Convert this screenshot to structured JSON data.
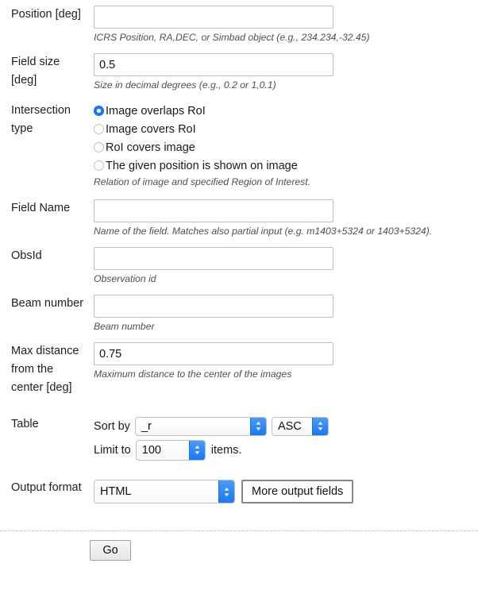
{
  "form": {
    "fields": {
      "position": {
        "label": "Position [deg]",
        "value": "",
        "placeholder": "",
        "hint": "ICRS Position, RA,DEC, or Simbad object (e.g., 234.234,-32.45)"
      },
      "field_size": {
        "label": "Field size [deg]",
        "value": "0.5",
        "placeholder": "",
        "hint": "Size in decimal degrees (e.g., 0.2 or 1,0.1)"
      },
      "intersection_type": {
        "label": "Intersection type",
        "hint": "Relation of image and specified Region of Interest.",
        "selected": "Image overlaps RoI",
        "options": [
          {
            "label": "Image overlaps RoI",
            "checked": true
          },
          {
            "label": "Image covers RoI",
            "checked": false
          },
          {
            "label": "RoI covers image",
            "checked": false
          },
          {
            "label": "The given position is shown on image",
            "checked": false
          }
        ]
      },
      "field_name": {
        "label": "Field Name",
        "value": "",
        "placeholder": "",
        "hint": "Name of the field. Matches also partial input (e.g. m1403+5324 or 1403+5324)."
      },
      "obsid": {
        "label": "ObsId",
        "value": "",
        "placeholder": "",
        "hint": "Observation id"
      },
      "beam_number": {
        "label": "Beam number",
        "value": "",
        "placeholder": "",
        "hint": "Beam number"
      },
      "max_distance": {
        "label": "Max distance from the center [deg]",
        "value": "0.75",
        "placeholder": "",
        "hint": "Maximum distance to the center of the images"
      },
      "table": {
        "label": "Table",
        "sort_by_label": "Sort by",
        "sort_by_value": "_r",
        "order_value": "ASC",
        "limit_prefix": "Limit to",
        "limit_value": "100",
        "limit_suffix": "items."
      },
      "output_format": {
        "label": "Output format",
        "value": "HTML",
        "more_fields_button": "More output fields"
      }
    },
    "submit_button": "Go"
  },
  "colors": {
    "accent_blue": "#0d7dfa",
    "select_arrow_blue": "#1878f5",
    "input_border": "#bdbdbd",
    "hint_text": "#4f4f4f",
    "divider": "#c4c4c4"
  },
  "icons": {
    "select_chevrons": "chevron-up-down-icon"
  }
}
